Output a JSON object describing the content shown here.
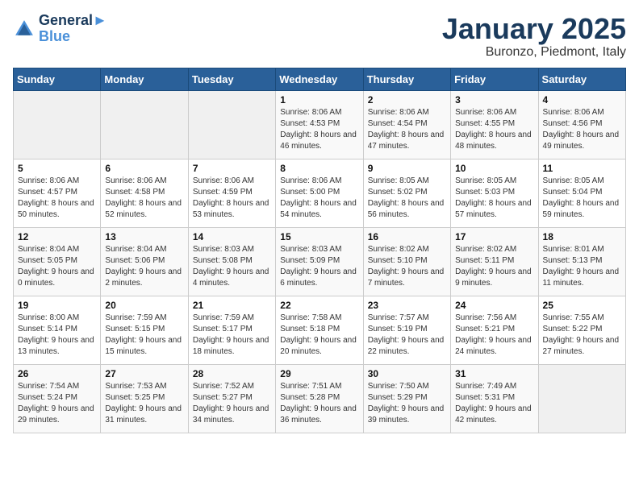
{
  "header": {
    "logo_line1": "General",
    "logo_line2": "Blue",
    "title": "January 2025",
    "subtitle": "Buronzo, Piedmont, Italy"
  },
  "weekdays": [
    "Sunday",
    "Monday",
    "Tuesday",
    "Wednesday",
    "Thursday",
    "Friday",
    "Saturday"
  ],
  "weeks": [
    [
      {
        "day": "",
        "info": ""
      },
      {
        "day": "",
        "info": ""
      },
      {
        "day": "",
        "info": ""
      },
      {
        "day": "1",
        "info": "Sunrise: 8:06 AM\nSunset: 4:53 PM\nDaylight: 8 hours and 46 minutes."
      },
      {
        "day": "2",
        "info": "Sunrise: 8:06 AM\nSunset: 4:54 PM\nDaylight: 8 hours and 47 minutes."
      },
      {
        "day": "3",
        "info": "Sunrise: 8:06 AM\nSunset: 4:55 PM\nDaylight: 8 hours and 48 minutes."
      },
      {
        "day": "4",
        "info": "Sunrise: 8:06 AM\nSunset: 4:56 PM\nDaylight: 8 hours and 49 minutes."
      }
    ],
    [
      {
        "day": "5",
        "info": "Sunrise: 8:06 AM\nSunset: 4:57 PM\nDaylight: 8 hours and 50 minutes."
      },
      {
        "day": "6",
        "info": "Sunrise: 8:06 AM\nSunset: 4:58 PM\nDaylight: 8 hours and 52 minutes."
      },
      {
        "day": "7",
        "info": "Sunrise: 8:06 AM\nSunset: 4:59 PM\nDaylight: 8 hours and 53 minutes."
      },
      {
        "day": "8",
        "info": "Sunrise: 8:06 AM\nSunset: 5:00 PM\nDaylight: 8 hours and 54 minutes."
      },
      {
        "day": "9",
        "info": "Sunrise: 8:05 AM\nSunset: 5:02 PM\nDaylight: 8 hours and 56 minutes."
      },
      {
        "day": "10",
        "info": "Sunrise: 8:05 AM\nSunset: 5:03 PM\nDaylight: 8 hours and 57 minutes."
      },
      {
        "day": "11",
        "info": "Sunrise: 8:05 AM\nSunset: 5:04 PM\nDaylight: 8 hours and 59 minutes."
      }
    ],
    [
      {
        "day": "12",
        "info": "Sunrise: 8:04 AM\nSunset: 5:05 PM\nDaylight: 9 hours and 0 minutes."
      },
      {
        "day": "13",
        "info": "Sunrise: 8:04 AM\nSunset: 5:06 PM\nDaylight: 9 hours and 2 minutes."
      },
      {
        "day": "14",
        "info": "Sunrise: 8:03 AM\nSunset: 5:08 PM\nDaylight: 9 hours and 4 minutes."
      },
      {
        "day": "15",
        "info": "Sunrise: 8:03 AM\nSunset: 5:09 PM\nDaylight: 9 hours and 6 minutes."
      },
      {
        "day": "16",
        "info": "Sunrise: 8:02 AM\nSunset: 5:10 PM\nDaylight: 9 hours and 7 minutes."
      },
      {
        "day": "17",
        "info": "Sunrise: 8:02 AM\nSunset: 5:11 PM\nDaylight: 9 hours and 9 minutes."
      },
      {
        "day": "18",
        "info": "Sunrise: 8:01 AM\nSunset: 5:13 PM\nDaylight: 9 hours and 11 minutes."
      }
    ],
    [
      {
        "day": "19",
        "info": "Sunrise: 8:00 AM\nSunset: 5:14 PM\nDaylight: 9 hours and 13 minutes."
      },
      {
        "day": "20",
        "info": "Sunrise: 7:59 AM\nSunset: 5:15 PM\nDaylight: 9 hours and 15 minutes."
      },
      {
        "day": "21",
        "info": "Sunrise: 7:59 AM\nSunset: 5:17 PM\nDaylight: 9 hours and 18 minutes."
      },
      {
        "day": "22",
        "info": "Sunrise: 7:58 AM\nSunset: 5:18 PM\nDaylight: 9 hours and 20 minutes."
      },
      {
        "day": "23",
        "info": "Sunrise: 7:57 AM\nSunset: 5:19 PM\nDaylight: 9 hours and 22 minutes."
      },
      {
        "day": "24",
        "info": "Sunrise: 7:56 AM\nSunset: 5:21 PM\nDaylight: 9 hours and 24 minutes."
      },
      {
        "day": "25",
        "info": "Sunrise: 7:55 AM\nSunset: 5:22 PM\nDaylight: 9 hours and 27 minutes."
      }
    ],
    [
      {
        "day": "26",
        "info": "Sunrise: 7:54 AM\nSunset: 5:24 PM\nDaylight: 9 hours and 29 minutes."
      },
      {
        "day": "27",
        "info": "Sunrise: 7:53 AM\nSunset: 5:25 PM\nDaylight: 9 hours and 31 minutes."
      },
      {
        "day": "28",
        "info": "Sunrise: 7:52 AM\nSunset: 5:27 PM\nDaylight: 9 hours and 34 minutes."
      },
      {
        "day": "29",
        "info": "Sunrise: 7:51 AM\nSunset: 5:28 PM\nDaylight: 9 hours and 36 minutes."
      },
      {
        "day": "30",
        "info": "Sunrise: 7:50 AM\nSunset: 5:29 PM\nDaylight: 9 hours and 39 minutes."
      },
      {
        "day": "31",
        "info": "Sunrise: 7:49 AM\nSunset: 5:31 PM\nDaylight: 9 hours and 42 minutes."
      },
      {
        "day": "",
        "info": ""
      }
    ]
  ]
}
